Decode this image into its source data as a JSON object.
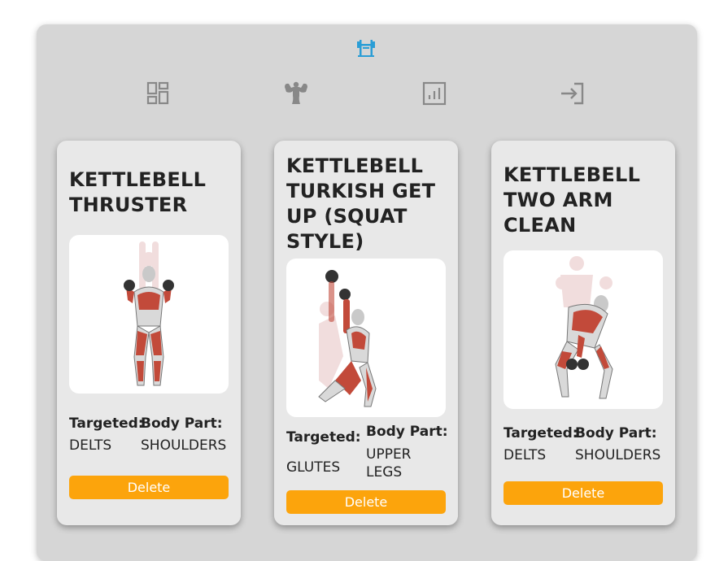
{
  "nav": {
    "logo_icon": "dumbbell-rack-icon",
    "items": [
      {
        "icon": "dashboard-icon"
      },
      {
        "icon": "muscle-icon"
      },
      {
        "icon": "analytics-icon"
      },
      {
        "icon": "login-icon"
      }
    ]
  },
  "colors": {
    "accent": "#fca40c",
    "panel": "#d6d6d6",
    "card": "#e8e8e8",
    "logo": "#2b9ed6"
  },
  "cards": [
    {
      "title": "KETTLEBELL THRUSTER",
      "targeted_label": "Targeted:",
      "targeted_value": "DELTS",
      "body_part_label": "Body Part:",
      "body_part_value": "SHOULDERS",
      "delete_label": "Delete"
    },
    {
      "title": "KETTLEBELL TURKISH GET UP (SQUAT STYLE)",
      "targeted_label": "Targeted:",
      "targeted_value": "GLUTES",
      "body_part_label": "Body Part:",
      "body_part_value": "UPPER LEGS",
      "delete_label": "Delete"
    },
    {
      "title": "KETTLEBELL TWO ARM CLEAN",
      "targeted_label": "Targeted:",
      "targeted_value": "DELTS",
      "body_part_label": "Body Part:",
      "body_part_value": "SHOULDERS",
      "delete_label": "Delete"
    }
  ]
}
